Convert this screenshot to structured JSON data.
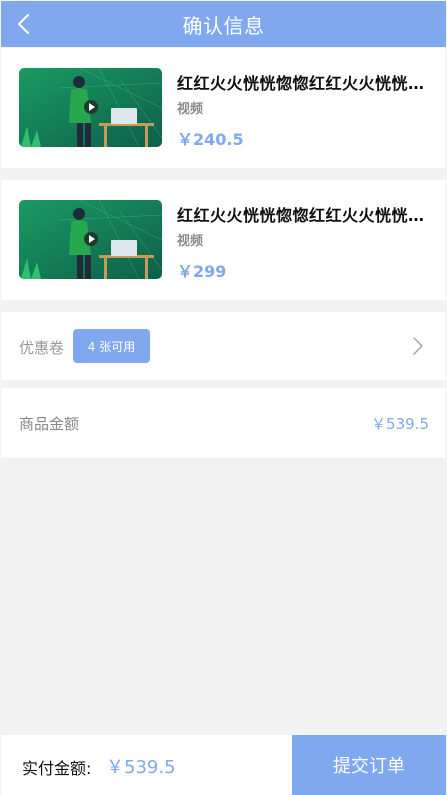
{
  "header": {
    "title": "确认信息",
    "back_icon": "chevron-left-icon"
  },
  "products": [
    {
      "title": "红红火火恍恍惚惚红红火火恍恍惚惚",
      "type": "视频",
      "price": "￥240.5",
      "thumbnail_icon": "video-thumbnail"
    },
    {
      "title": "红红火火恍恍惚惚红红火火恍恍惚惚",
      "type": "视频",
      "price": "￥299",
      "thumbnail_icon": "video-thumbnail"
    }
  ],
  "coupon": {
    "label": "优惠卷",
    "badge": "4 张可用",
    "chevron_icon": "chevron-right-icon"
  },
  "amount": {
    "label": "商品金额",
    "value": "￥539.5"
  },
  "footer": {
    "pay_label": "实付金额:",
    "pay_value": "￥539.5",
    "submit_label": "提交订单"
  },
  "colors": {
    "accent": "#7fa8ee",
    "background": "#f2f2f2",
    "card": "#ffffff"
  }
}
